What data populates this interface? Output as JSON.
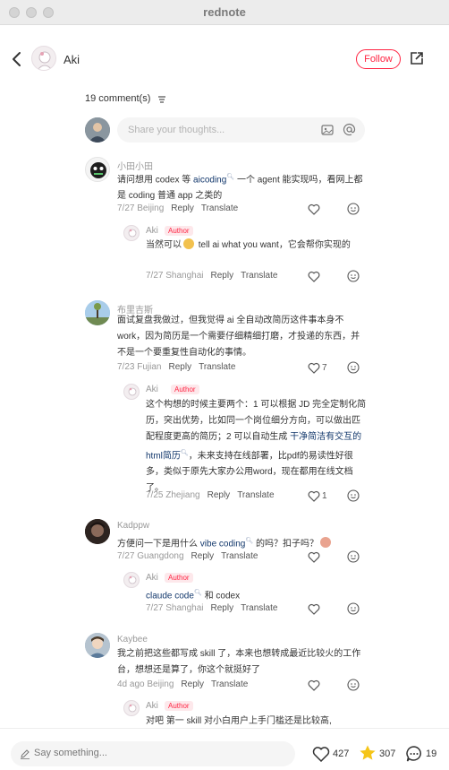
{
  "window": {
    "title": "rednote"
  },
  "header": {
    "author_name": "Aki",
    "follow_label": "Follow"
  },
  "comments_header": {
    "count_label": "19 comment(s)"
  },
  "composer": {
    "placeholder": "Share your thoughts..."
  },
  "comments": [
    {
      "user": "小田小田",
      "text_parts": [
        "请问想用 codex 等 ",
        "aicoding",
        " 一个 agent 能实现吗，看网上都是 coding 普通 app 之类的"
      ],
      "date": "7/27",
      "location": "Beijing",
      "likes": "",
      "reply_label": "Reply",
      "translate_label": "Translate",
      "reply": {
        "user": "Aki",
        "badge": "Author",
        "text_parts": [
          "当然可以",
          " tell ai what you want，它会帮你实现的"
        ],
        "date": "7/27",
        "location": "Shanghai",
        "likes": ""
      }
    },
    {
      "user": "布里吉斯",
      "text": "面试复盘我做过，但我觉得 ai 全自动改简历这件事本身不 work，因为简历是一个需要仔细精细打磨，才投递的东西，并不是一个要重复性自动化的事情。",
      "date": "7/23",
      "location": "Fujian",
      "likes": "7",
      "reply": {
        "user": "Aki",
        "badge": "Author",
        "text_parts": [
          "这个构想的时候主要两个：1 可以根据 JD 完全定制化简历，突出优势，比如同一个岗位细分方向，可以做出匹配程度更高的简历；2 可以自动生成 ",
          "干净简洁有交互的html简历",
          "，未来支持在线部署，比pdf的易读性好很多，类似于原先大家办公用word，现在都用在线文档了。"
        ],
        "date": "7/25",
        "location": "Zhejiang",
        "likes": "1"
      }
    },
    {
      "user": "Kadppw",
      "text_parts": [
        "方便问一下是用什么 ",
        "vibe coding",
        " 的吗？扣子吗？"
      ],
      "date": "7/27",
      "location": "Guangdong",
      "likes": "",
      "reply": {
        "user": "Aki",
        "badge": "Author",
        "text_parts": [
          "claude code",
          " 和 codex"
        ],
        "date": "7/27",
        "location": "Shanghai",
        "likes": ""
      }
    },
    {
      "user": "Kaybee",
      "text": "我之前把这些都写成 skill 了，本来也想转成最近比较火的工作台，想想还是算了，你这个就挺好了",
      "date": "4d ago",
      "location": "Beijing",
      "likes": "",
      "reply": {
        "user": "Aki",
        "badge": "Author",
        "text": "对吧 第一 skill 对小白用户上手门槛还是比较高,"
      }
    }
  ],
  "labels": {
    "reply": "Reply",
    "translate": "Translate"
  },
  "bottom_bar": {
    "say_placeholder": "Say something...",
    "likes": "427",
    "stars": "307",
    "comments": "19"
  },
  "colors": {
    "brand": "#ff2442",
    "keyword": "#13386c",
    "star": "#f5c518"
  }
}
